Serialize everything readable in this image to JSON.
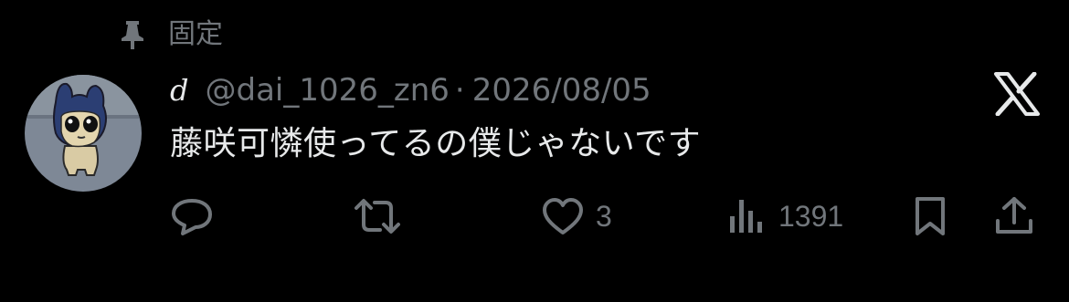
{
  "pinned": {
    "label": "固定",
    "icon": "pin-icon"
  },
  "tweet": {
    "author": {
      "display_name": "d",
      "handle": "@dai_1026_zn6"
    },
    "separator": "·",
    "date": "2026/08/05",
    "text": "藤咲可憐使ってるの僕じゃないです",
    "actions": {
      "reply": {
        "icon": "reply-icon"
      },
      "retweet": {
        "icon": "retweet-icon"
      },
      "like": {
        "icon": "heart-icon",
        "count": "3"
      },
      "views": {
        "icon": "views-icon",
        "count": "1391"
      },
      "bookmark": {
        "icon": "bookmark-icon"
      },
      "share": {
        "icon": "share-icon"
      }
    }
  },
  "brand": {
    "icon": "x-logo-icon"
  },
  "colors": {
    "background": "#000000",
    "primary_text": "#e7e9ea",
    "secondary_text": "#71767b"
  }
}
